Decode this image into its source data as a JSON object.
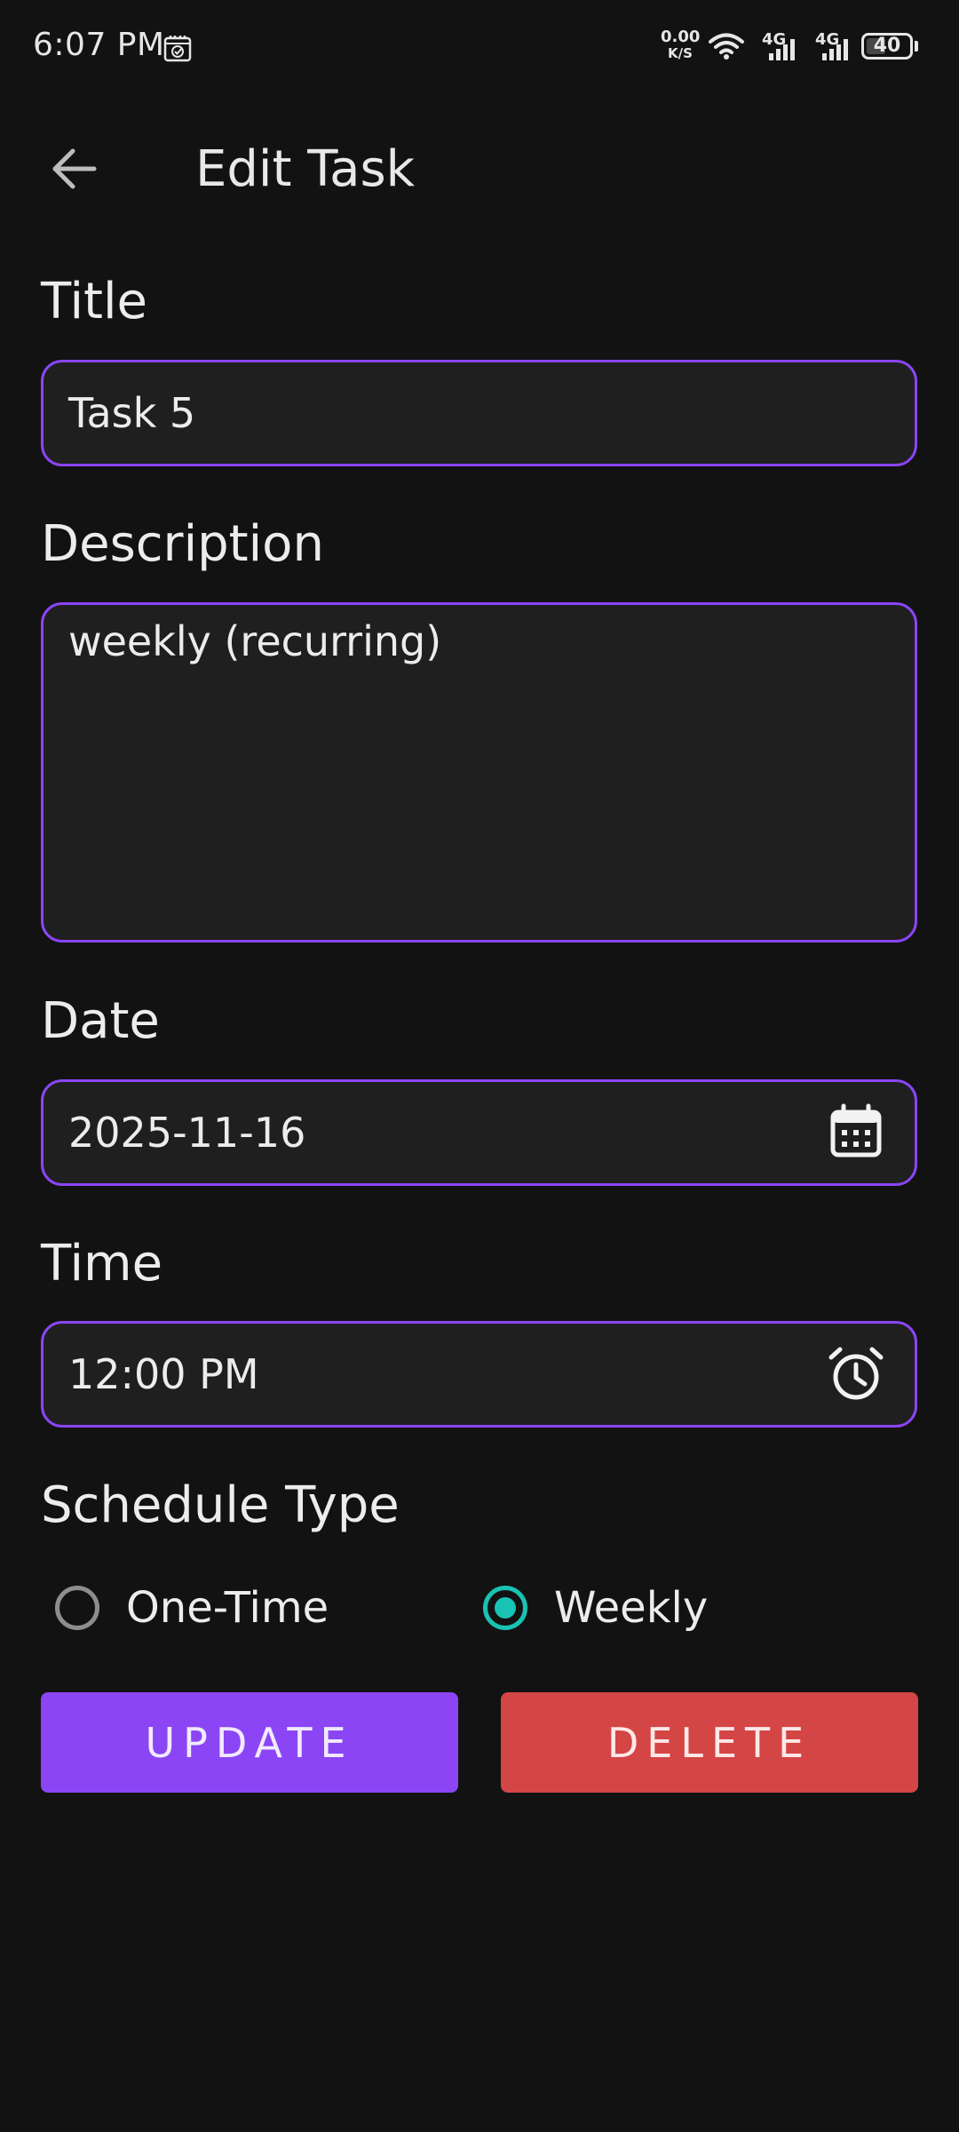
{
  "status_bar": {
    "time": "6:07 PM",
    "net_speed_value": "0.00",
    "net_speed_unit": "K/S",
    "signal_1_label": "4G",
    "signal_2_label": "4G",
    "battery_level": "40"
  },
  "app_bar": {
    "title": "Edit Task",
    "back_icon": "arrow-back-icon"
  },
  "form": {
    "title_label": "Title",
    "title_value": "Task 5",
    "description_label": "Description",
    "description_value": "weekly (recurring)",
    "date_label": "Date",
    "date_value": "2025-11-16",
    "date_icon": "calendar-icon",
    "time_label": "Time",
    "time_value": "12:00 PM",
    "time_icon": "alarm-clock-icon",
    "schedule_label": "Schedule Type",
    "schedule_options": [
      {
        "label": "One-Time",
        "selected": false
      },
      {
        "label": "Weekly",
        "selected": true
      }
    ]
  },
  "actions": {
    "update_label": "UPDATE",
    "delete_label": "DELETE"
  },
  "colors": {
    "background": "#121212",
    "field_border": "#8b45f5",
    "radio_selected": "#19c3b3",
    "update_button": "#8b45f5",
    "delete_button": "#d44545"
  }
}
